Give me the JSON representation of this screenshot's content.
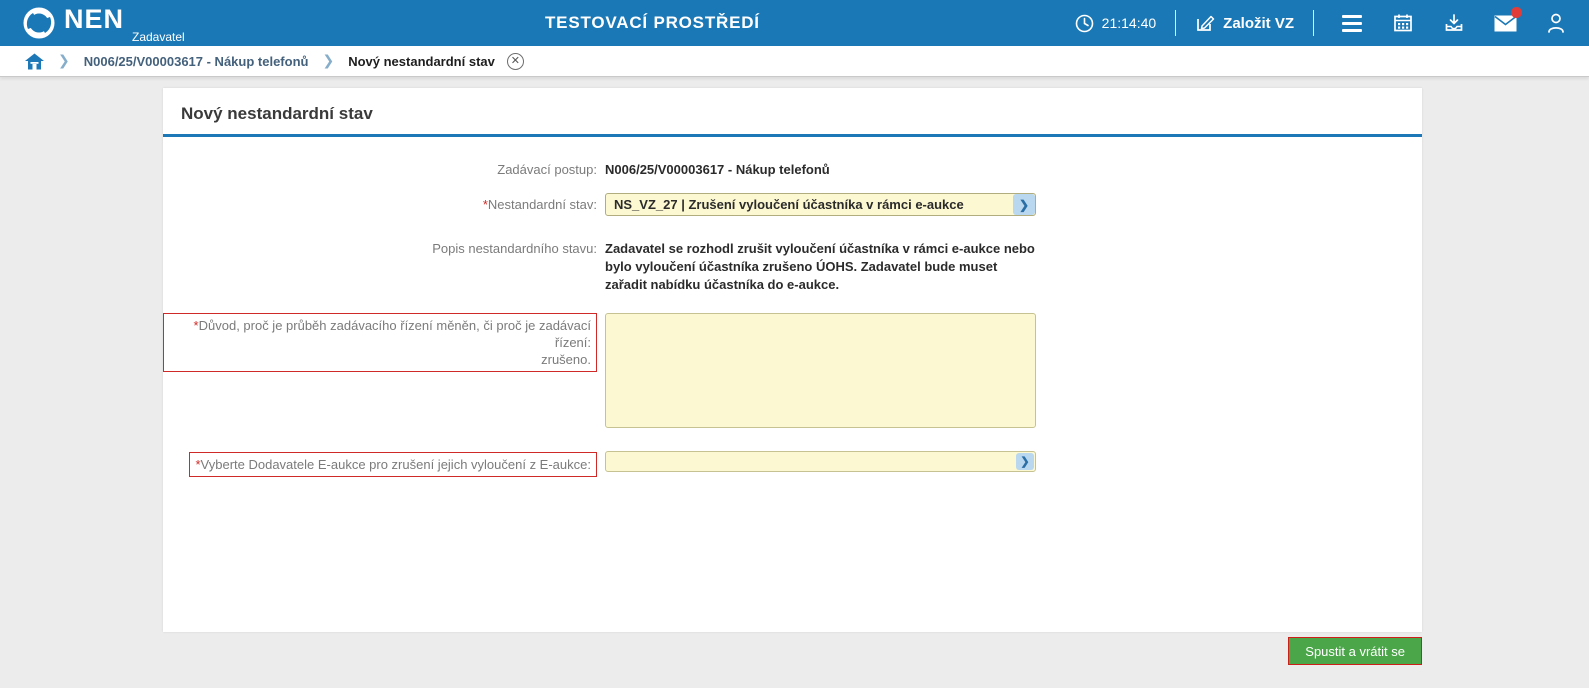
{
  "header": {
    "logo_text": "NEN",
    "logo_subtitle": "Zadavatel",
    "environment_title": "TESTOVACÍ PROSTŘEDÍ",
    "time": "21:14:40",
    "create_vz_label": "Založit VZ"
  },
  "breadcrumb": {
    "items": [
      "N006/25/V00003617 - Nákup telefonů",
      "Nový nestandardní stav"
    ]
  },
  "form": {
    "title": "Nový nestandardní stav",
    "fields": {
      "zadavaci_postup": {
        "label": "Zadávací postup:",
        "value": "N006/25/V00003617 - Nákup telefonů"
      },
      "nestandardni_stav": {
        "required": "*",
        "label": "Nestandardní stav:",
        "value": "NS_VZ_27 | Zrušení vyloučení účastníka v rámci e-aukce"
      },
      "popis": {
        "label": "Popis nestandardního stavu:",
        "value": "Zadavatel se rozhodl zrušit vyloučení účastníka v rámci e-aukce nebo bylo vyloučení účastníka zrušeno ÚOHS. Zadavatel bude muset zařadit nabídku účastníka do e-aukce."
      },
      "duvod": {
        "required": "*",
        "label": "Důvod, proč je průběh zadávacího řízení měněn, či proč je zadávací řízení:\nzrušeno.",
        "value": ""
      },
      "dodavatele": {
        "required": "*",
        "label": "Vyberte Dodavatele E-aukce pro zrušení jejich vyloučení z E-aukce:",
        "value": ""
      }
    }
  },
  "footer": {
    "submit_label": "Spustit a vrátit se"
  },
  "colors": {
    "header_blue": "#1b78b6",
    "accent_blue": "#1d78b8",
    "field_yellow": "#fcf8d2",
    "required_red": "#cf2a27",
    "button_green": "#4ba64a",
    "notification_red": "#e23c39"
  }
}
